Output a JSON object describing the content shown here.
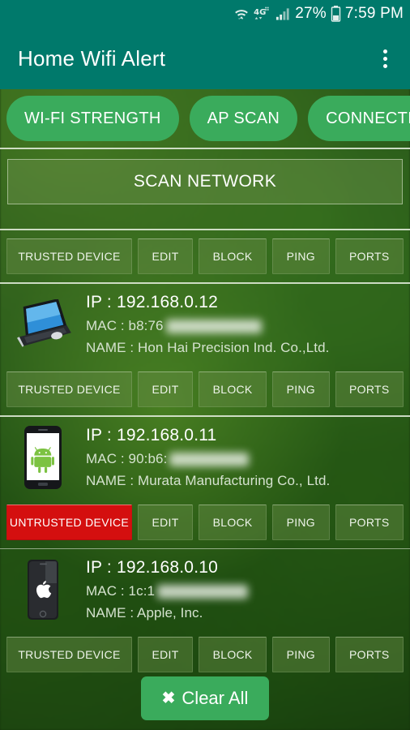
{
  "status_bar": {
    "wifi_icon": "wifi-icon",
    "network_label": "4G",
    "network_icon": "lte-icon",
    "signal_icon": "signal-bars-icon",
    "battery_percent": "27%",
    "battery_icon": "battery-low-icon",
    "time": "7:59 PM"
  },
  "app_bar": {
    "title": "Home Wifi Alert",
    "overflow_icon": "overflow-menu-icon"
  },
  "tabs": [
    {
      "label": "WI-FI STRENGTH"
    },
    {
      "label": "AP SCAN"
    },
    {
      "label": "CONNECTIONS"
    }
  ],
  "scan": {
    "button_label": "SCAN NETWORK"
  },
  "actions": {
    "trusted": "TRUSTED DEVICE",
    "untrusted": "UNTRUSTED DEVICE",
    "edit": "EDIT",
    "block": "BLOCK",
    "ping": "PING",
    "ports": "PORTS"
  },
  "labels": {
    "ip_prefix": "IP : ",
    "mac_prefix": "MAC : ",
    "name_prefix": "NAME : "
  },
  "devices": [
    {
      "icon": "laptop-icon",
      "ip": "IP : 192.168.0.12",
      "mac": "MAC : b8:76",
      "name": "NAME : Hon Hai Precision Ind. Co.,Ltd.",
      "trust_label": "TRUSTED DEVICE",
      "trusted": true
    },
    {
      "icon": "android-phone-icon",
      "ip": "IP : 192.168.0.11",
      "mac": "MAC : 90:b6:",
      "name": "NAME : Murata Manufacturing Co., Ltd.",
      "trust_label": "UNTRUSTED DEVICE",
      "trusted": false
    },
    {
      "icon": "iphone-icon",
      "ip": "IP : 192.168.0.10",
      "mac": "MAC : 1c:1",
      "name": "NAME : Apple, Inc.",
      "trust_label": "TRUSTED DEVICE",
      "trusted": true
    }
  ],
  "bottom": {
    "clear_all_label": "Clear All",
    "clear_all_icon": "close-x-icon"
  },
  "colors": {
    "appbar_teal": "#00796b",
    "tab_green": "#3aab5c",
    "danger_red": "#d40f0f",
    "background_green": "#2b5c1b"
  }
}
